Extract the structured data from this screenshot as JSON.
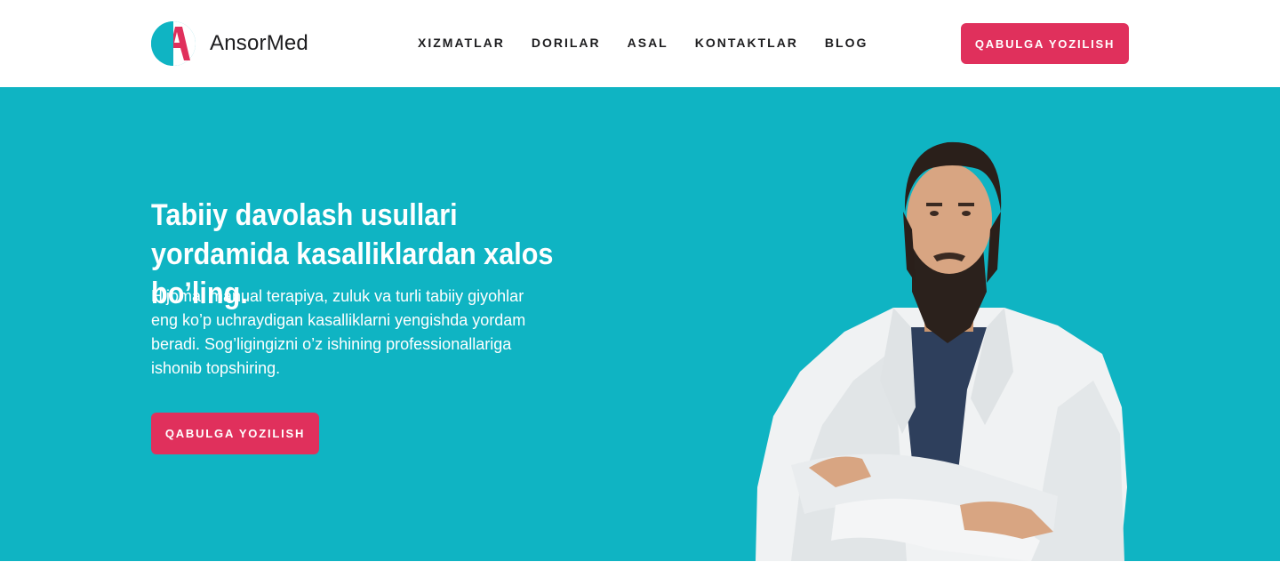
{
  "brand": {
    "name": "AnsorMed",
    "accent": "#e0305c",
    "teal": "#0fb4c3"
  },
  "nav": {
    "items": [
      {
        "label": "XIZMATLAR"
      },
      {
        "label": "DORILAR"
      },
      {
        "label": "ASAL"
      },
      {
        "label": "KONTAKTLAR"
      },
      {
        "label": "BLOG"
      }
    ]
  },
  "header": {
    "cta_label": "QABULGA YOZILISH"
  },
  "hero": {
    "title": "Tabiiy davolash usullari yordamida kasalliklardan xalos bo’ling.",
    "text": "Hijoma, manual terapiya, zuluk va turli tabiiy giyohlar eng ko’p uchraydigan kasalliklarni yengishda yordam beradi. Sog’ligingizni o’z ishining professionallariga ishonib topshiring.",
    "cta_label": "QABULGA YOZILISH"
  },
  "icons": {
    "logo": "ansormed-logo-icon",
    "doctor": "doctor-photo"
  }
}
